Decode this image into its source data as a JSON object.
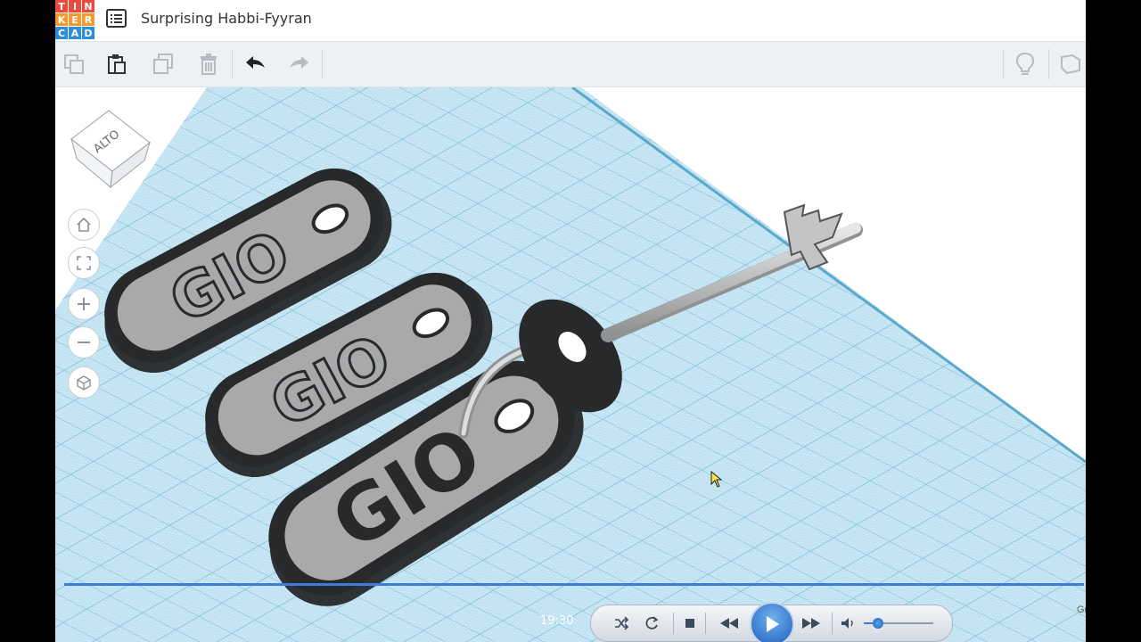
{
  "app": {
    "logo_letters": [
      "T",
      "I",
      "N",
      "K",
      "E",
      "R",
      "C",
      "A",
      "D"
    ],
    "logo_colors": [
      "#e94b3c",
      "#e94b3c",
      "#e94b3c",
      "#f29a2e",
      "#f29a2e",
      "#f29a2e",
      "#2a8fd6",
      "#2a8fd6",
      "#2a8fd6"
    ],
    "title": "Surprising Habbi-Fyyran"
  },
  "toolbar": {
    "items": [
      {
        "name": "copy-icon",
        "enabled": false
      },
      {
        "name": "paste-icon",
        "enabled": true
      },
      {
        "name": "duplicate-icon",
        "enabled": false
      },
      {
        "name": "delete-icon",
        "enabled": false
      },
      {
        "name": "undo-icon",
        "enabled": true
      },
      {
        "name": "redo-icon",
        "enabled": false
      },
      {
        "name": "lightbulb-icon",
        "enabled": false
      },
      {
        "name": "notes-icon",
        "enabled": false
      }
    ]
  },
  "viewcube": {
    "face_label": "ALTO"
  },
  "navigation": [
    "home-icon",
    "fit-view-icon",
    "zoom-in-icon",
    "zoom-out-icon",
    "perspective-icon"
  ],
  "scene": {
    "keychain_labels": [
      "GIO",
      "GIO",
      "GIO"
    ],
    "colors": {
      "workplane": "#c9e7f4",
      "grid_minor": "#8fc6de",
      "grid_major": "#5ba8cc",
      "tag_body": "#27292b",
      "tag_face": "#a7a9ab",
      "key_metal": "#c2c4c6"
    }
  },
  "player": {
    "time": "19:30",
    "state": "paused",
    "volume_fraction": 0.2,
    "progress_fraction": 0.99,
    "controls": [
      "shuffle-icon",
      "repeat-icon",
      "stop-icon",
      "previous-icon",
      "play-icon",
      "next-icon",
      "volume-icon"
    ],
    "accent": "#3b7dd8"
  },
  "extra_text": "Gr"
}
